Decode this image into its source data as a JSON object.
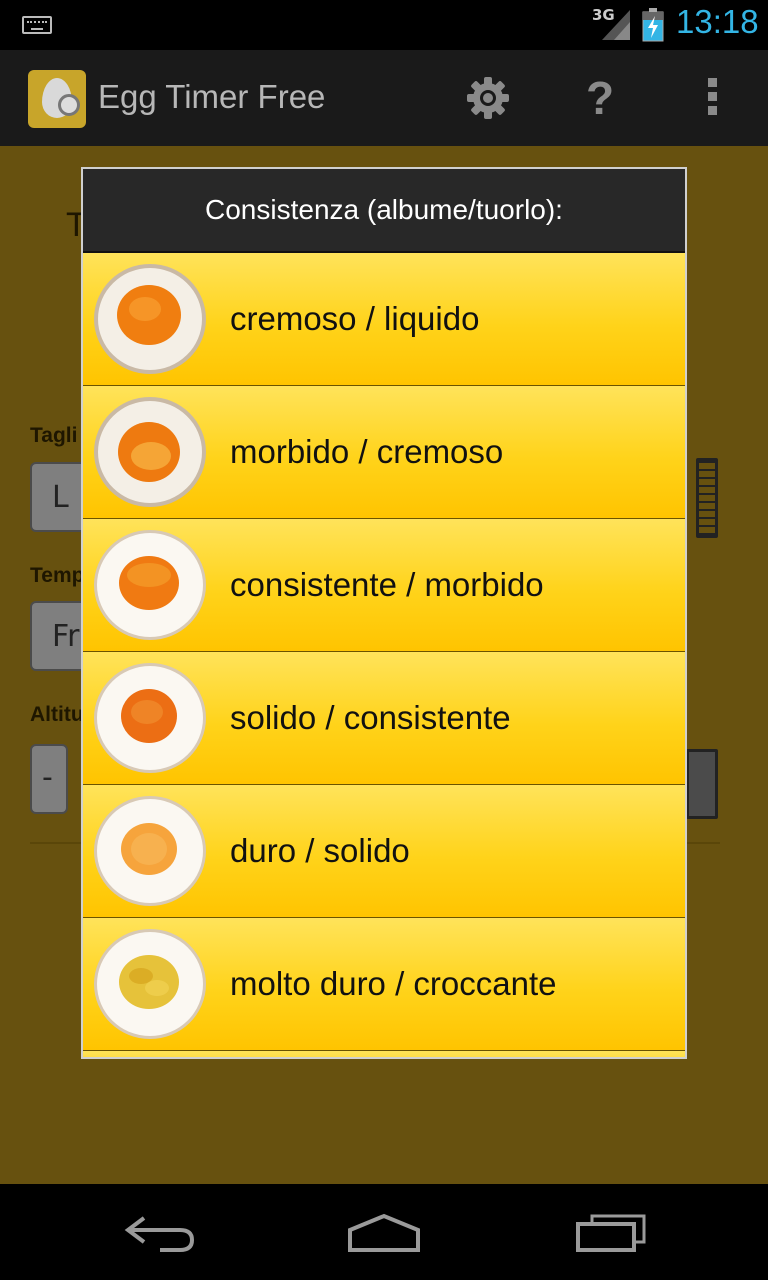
{
  "status_bar": {
    "network": "3G",
    "time": "13:18",
    "accent_color": "#33b5e5",
    "icons": [
      "keyboard-icon",
      "signal-icon",
      "battery-charging-icon"
    ]
  },
  "action_bar": {
    "title": "Egg Timer Free",
    "icons": [
      "app-logo-icon",
      "gear-icon",
      "help-icon",
      "overflow-menu-icon"
    ],
    "help_glyph": "?"
  },
  "background": {
    "labels": [
      "Tagli",
      "Temp",
      "Altitu"
    ],
    "size_value": "L",
    "temp_value": "Fr",
    "altitude_minus": "-",
    "partial_title_letter": "T",
    "colors": {
      "panel": "#67510f"
    }
  },
  "dialog": {
    "title": "Consistenza (albume/tuorlo):",
    "options": [
      {
        "label": "cremoso / liquido",
        "icon": "egg-runny-icon"
      },
      {
        "label": "morbido / cremoso",
        "icon": "egg-soft-icon"
      },
      {
        "label": "consistente / morbido",
        "icon": "egg-medium-icon"
      },
      {
        "label": "solido / consistente",
        "icon": "egg-firm-icon"
      },
      {
        "label": "duro / solido",
        "icon": "egg-hard-icon"
      },
      {
        "label": "molto duro / croccante",
        "icon": "egg-very-hard-icon"
      }
    ],
    "colors": {
      "header": "#282828",
      "option_top": "#ffe35a",
      "option_bottom": "#ffc400"
    }
  },
  "nav_bar": {
    "icons": [
      "back-icon",
      "home-icon",
      "recent-apps-icon"
    ]
  }
}
